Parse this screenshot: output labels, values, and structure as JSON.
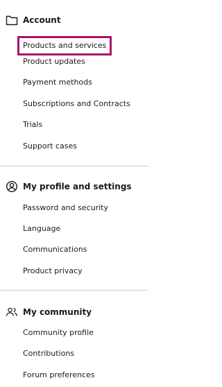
{
  "account": {
    "title": "Account",
    "icon": "folder-icon",
    "items": [
      {
        "label": "Products and services",
        "selected": true
      },
      {
        "label": "Product updates"
      },
      {
        "label": "Payment methods"
      },
      {
        "label": "Subscriptions and Contracts"
      },
      {
        "label": "Trials"
      },
      {
        "label": "Support cases"
      }
    ]
  },
  "profile": {
    "title": "My profile and settings",
    "icon": "user-circle-icon",
    "items": [
      {
        "label": "Password and security"
      },
      {
        "label": "Language"
      },
      {
        "label": "Communications"
      },
      {
        "label": "Product privacy"
      }
    ]
  },
  "community": {
    "title": "My community",
    "icon": "users-icon",
    "items": [
      {
        "label": "Community profile"
      },
      {
        "label": "Contributions"
      },
      {
        "label": "Forum preferences"
      }
    ]
  },
  "colors": {
    "selected_border": "#a5166a",
    "divider": "#cfcfcf",
    "text": "#1a1a1a"
  }
}
